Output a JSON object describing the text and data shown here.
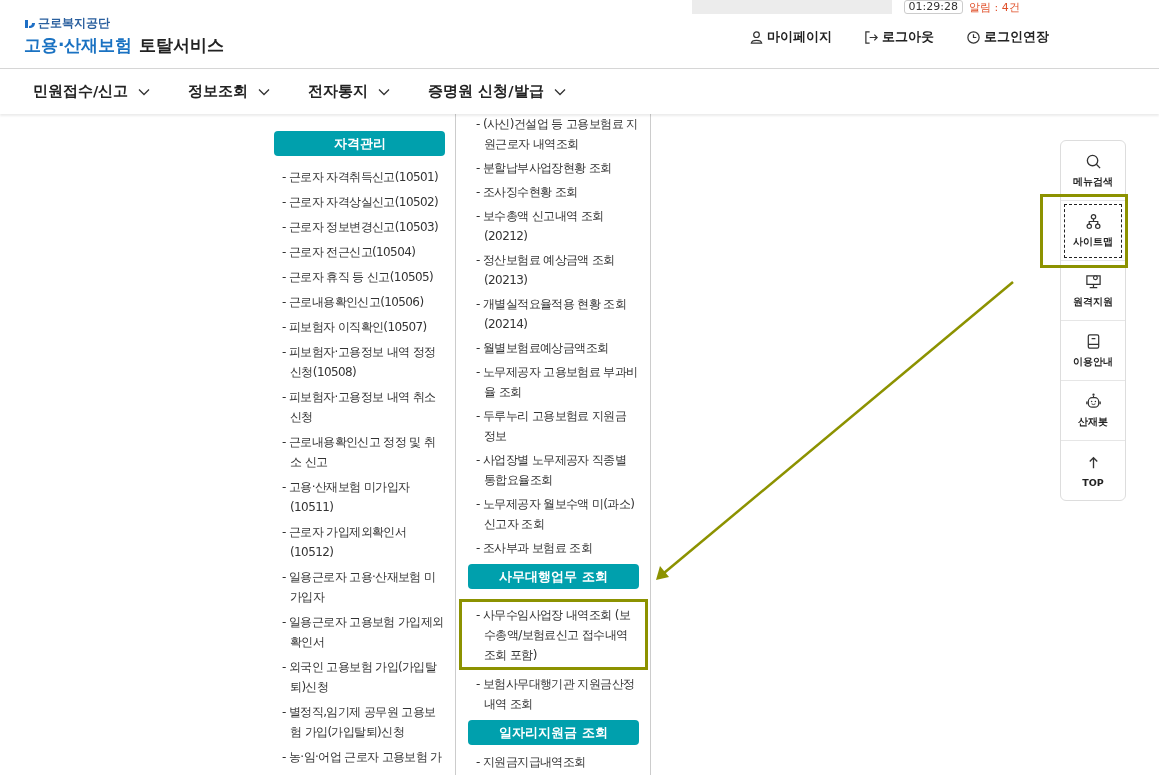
{
  "header": {
    "org": "근로복지공단",
    "title_main": "고용·산재보험",
    "title_sub": "토탈서비스",
    "timer": "01:29:28",
    "alert": "알림 : 4건",
    "user_links": [
      {
        "kind": "person",
        "label": "마이페이지"
      },
      {
        "kind": "logout",
        "label": "로그아웃"
      },
      {
        "kind": "clock",
        "label": "로그인연장"
      }
    ]
  },
  "nav": [
    {
      "label": "민원접수/신고",
      "expanded": false
    },
    {
      "label": "정보조회",
      "expanded": false
    },
    {
      "label": "전자통지",
      "expanded": false
    },
    {
      "label": "증명원 신청/발급",
      "expanded": false
    }
  ],
  "columns": [
    {
      "sections": [
        {
          "heading": "자격관리",
          "items": [
            {
              "label": "- 근로자 자격취득신고(10501)",
              "highlighted": false
            },
            {
              "label": "- 근로자 자격상실신고(10502)",
              "highlighted": false
            },
            {
              "label": "- 근로자 정보변경신고(10503)",
              "highlighted": false
            },
            {
              "label": "- 근로자 전근신고(10504)",
              "highlighted": false
            },
            {
              "label": "- 근로자 휴직 등 신고(10505)",
              "highlighted": false
            },
            {
              "label": "- 근로내용확인신고(10506)",
              "highlighted": false
            },
            {
              "label": "- 피보험자 이직확인(10507)",
              "highlighted": false
            },
            {
              "label": "- 피보험자·고용정보 내역 정정 신청(10508)",
              "highlighted": false
            },
            {
              "label": "- 피보험자·고용정보 내역 취소 신청",
              "highlighted": false
            },
            {
              "label": "- 근로내용확인신고 정정 및 취소 신고",
              "highlighted": false
            },
            {
              "label": "- 고용·산재보험 미가입자 (10511)",
              "highlighted": false
            },
            {
              "label": "- 근로자 가입제외확인서 (10512)",
              "highlighted": false
            },
            {
              "label": "- 일용근로자 고용·산재보험 미가입자",
              "highlighted": false
            },
            {
              "label": "- 일용근로자 고용보험 가입제외 확인서",
              "highlighted": false
            },
            {
              "label": "- 외국인 고용보험 가입(가입탈퇴)신청",
              "highlighted": false
            },
            {
              "label": "- 별정직,임기제 공무원 고용보험 가입(가입탈퇴)신청",
              "highlighted": false
            },
            {
              "label": "- 농·임·어업 근로자 고용보험 가",
              "highlighted": false
            }
          ]
        }
      ]
    },
    {
      "sections": [
        {
          "items": [
            {
              "label": "- (사신)건설업 등 고용보험료 지원근로자 내역조회",
              "highlighted": false
            },
            {
              "label": "- 분할납부사업장현황 조회",
              "highlighted": false
            },
            {
              "label": "- 조사징수현황 조회",
              "highlighted": false
            },
            {
              "label": "- 보수총액 신고내역 조회 (20212)",
              "highlighted": false
            },
            {
              "label": "- 정산보험료 예상금액 조회 (20213)",
              "highlighted": false
            },
            {
              "label": "- 개별실적요율적용 현황 조회 (20214)",
              "highlighted": false
            },
            {
              "label": "- 월별보험료예상금액조회",
              "highlighted": false
            },
            {
              "label": "- 노무제공자 고용보험료 부과비율 조회",
              "highlighted": false
            },
            {
              "label": "- 두루누리 고용보험료 지원금 정보",
              "highlighted": false
            },
            {
              "label": "- 사업장별 노무제공자 직종별 통합요율조회",
              "highlighted": false
            },
            {
              "label": "- 노무제공자 월보수액 미(과소) 신고자 조회",
              "highlighted": false
            },
            {
              "label": "- 조사부과 보험료 조회",
              "highlighted": false
            }
          ]
        },
        {
          "heading": "사무대행업무 조회",
          "items": [
            {
              "label": "- 사무수임사업장 내역조회 (보수총액/보험료신고 접수내역 조회 포함)",
              "highlighted": true
            },
            {
              "label": "- 보험사무대행기관 지원금산정 내역 조회",
              "highlighted": false
            }
          ]
        },
        {
          "heading": "일자리지원금 조회",
          "items": [
            {
              "label": "- 지원금지급내역조회",
              "highlighted": false
            }
          ]
        }
      ]
    }
  ],
  "quick_menu": [
    {
      "kind": "search",
      "label": "메뉴검색",
      "selected": false,
      "highlighted": false
    },
    {
      "kind": "sitemap",
      "label": "사이트맵",
      "selected": true,
      "highlighted": true
    },
    {
      "kind": "remote",
      "label": "원격지원",
      "selected": false,
      "highlighted": false
    },
    {
      "kind": "guide",
      "label": "이용안내",
      "selected": false,
      "highlighted": false
    },
    {
      "kind": "bot",
      "label": "산재봇",
      "selected": false,
      "highlighted": false
    },
    {
      "kind": "top",
      "label": "TOP",
      "selected": false,
      "highlighted": false
    }
  ]
}
